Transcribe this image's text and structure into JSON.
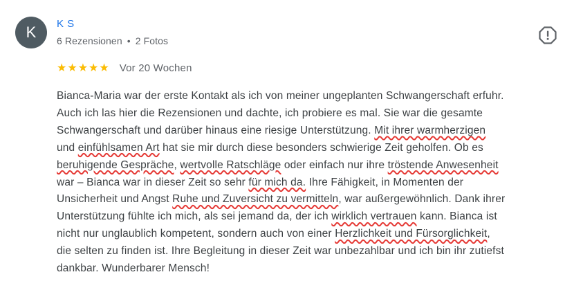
{
  "reviewer": {
    "avatar_letter": "K",
    "name": "K S",
    "reviews_count": "6 Rezensionen",
    "separator": "•",
    "photos_count": "2 Fotos"
  },
  "report_icon": "report-flag-icon",
  "rating": {
    "stars": 5,
    "max_stars": 5,
    "star_color": "#fbbc04",
    "date": "Vor 20 Wochen"
  },
  "highlight_color": "#e53935",
  "review": {
    "lines": [
      [
        {
          "t": "Bianca-Maria war der erste Kontakt als ich von meiner ungeplanten Schwangerschaft erfuhr."
        }
      ],
      [
        {
          "t": "Auch ich las hier die Rezensionen und dachte, ich probiere es mal. Sie war die gesamte"
        }
      ],
      [
        {
          "t": "Schwangerschaft und darüber hinaus eine riesige Unterstützung. "
        },
        {
          "t": "Mit ihrer warmherzigen",
          "hl": true
        }
      ],
      [
        {
          "t": "und "
        },
        {
          "t": "einfühlsamen Art",
          "hl": true
        },
        {
          "t": " hat sie mir durch diese besonders schwierige Zeit geholfen. Ob es"
        }
      ],
      [
        {
          "t": "beruhigende Gespräche",
          "hl": true
        },
        {
          "t": ", "
        },
        {
          "t": "wertvolle Ratschläge",
          "hl": true
        },
        {
          "t": " oder einfach nur ihre "
        },
        {
          "t": "tröstende Anwesenheit",
          "hl": true
        }
      ],
      [
        {
          "t": "war – Bianca war in dieser Zeit so sehr "
        },
        {
          "t": "für mich da.",
          "hl": true
        },
        {
          "t": " Ihre Fähigkeit, in Momenten der"
        }
      ],
      [
        {
          "t": "Unsicherheit und Angst "
        },
        {
          "t": "Ruhe und Zuversicht zu vermitteln",
          "hl": true
        },
        {
          "t": ", war außergewöhnlich. Dank ihrer"
        }
      ],
      [
        {
          "t": "Unterstützung fühlte ich mich, als sei jemand da, der ich "
        },
        {
          "t": "wirklich vertrauen",
          "hl": true
        },
        {
          "t": " kann. Bianca ist"
        }
      ],
      [
        {
          "t": "nicht nur unglaublich kompetent, sondern auch von einer "
        },
        {
          "t": "Herzlichkeit und Fürsorglichkeit",
          "hl": true
        },
        {
          "t": ","
        }
      ],
      [
        {
          "t": "die selten zu finden ist. Ihre Begleitung in dieser Zeit war unbezahlbar und ich bin ihr zutiefst"
        }
      ],
      [
        {
          "t": "dankbar. Wunderbarer Mensch!"
        }
      ]
    ]
  }
}
